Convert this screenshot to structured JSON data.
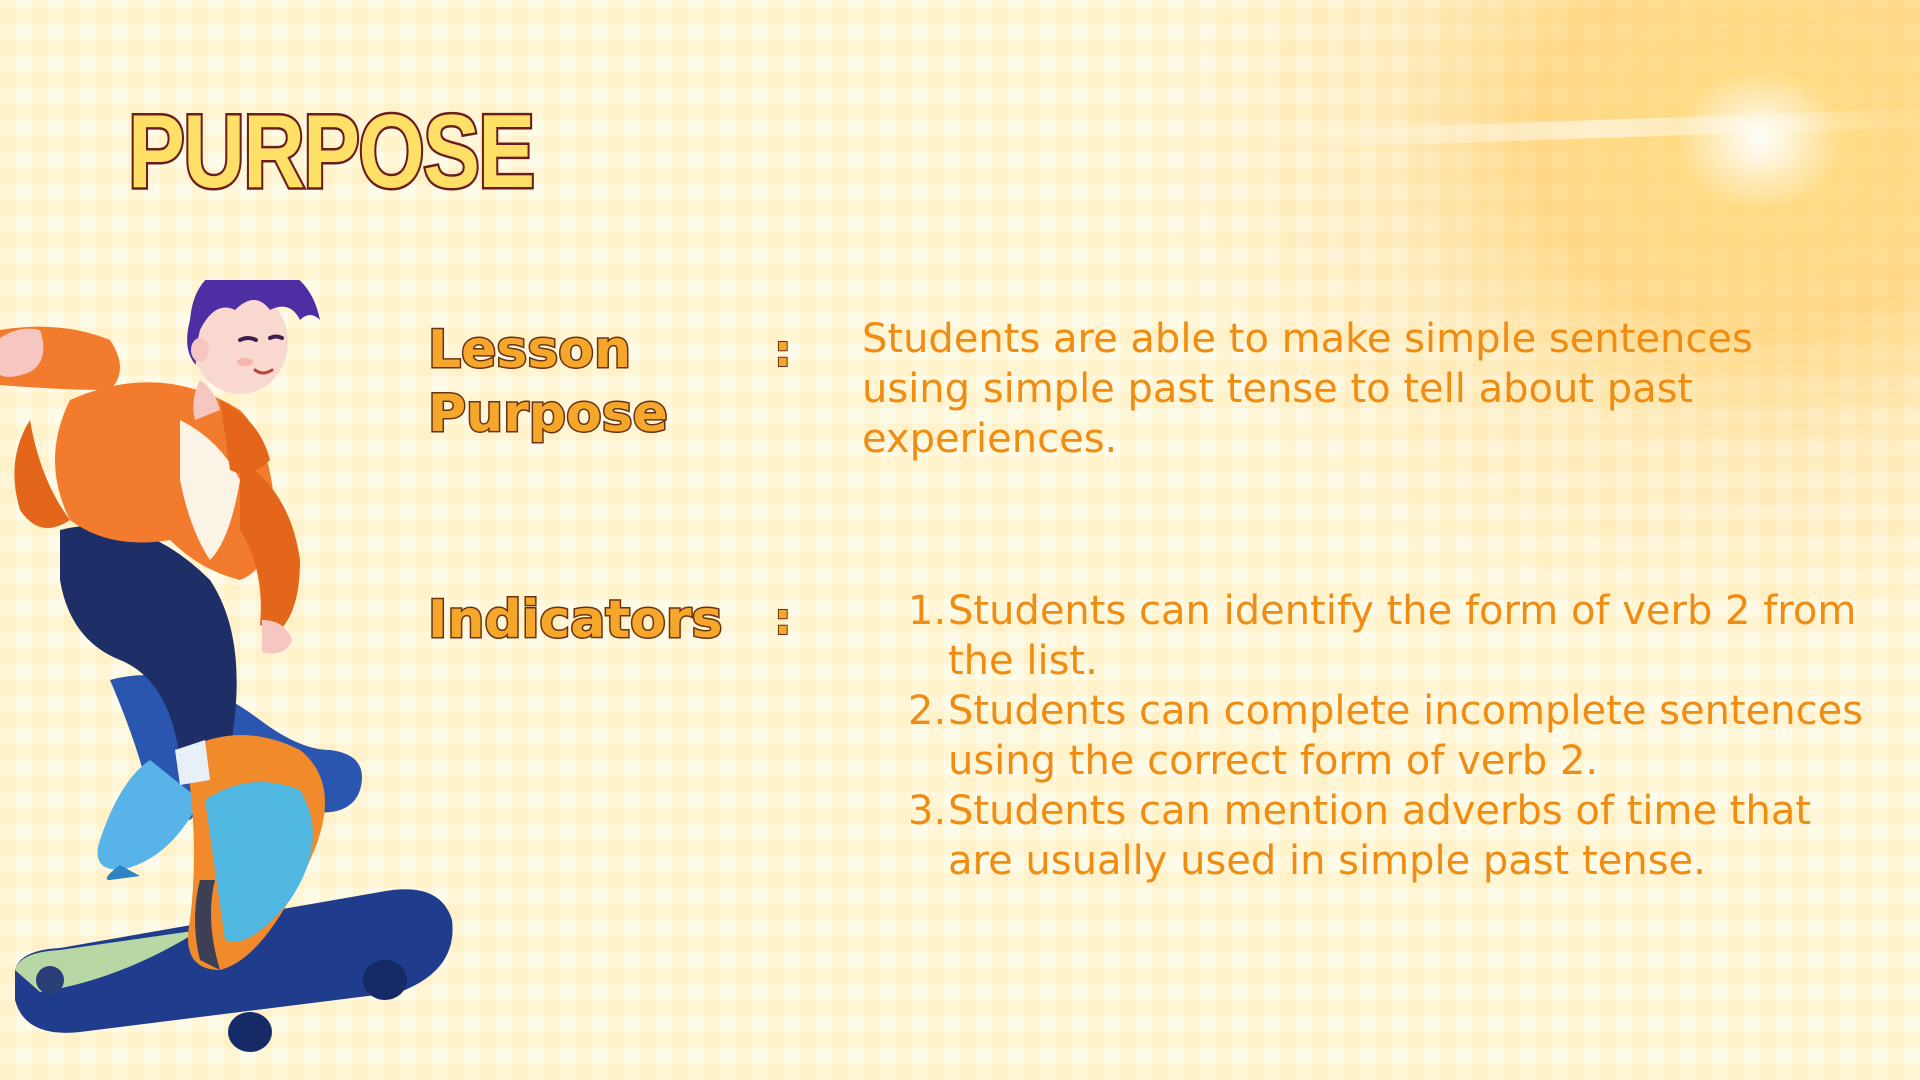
{
  "slide": {
    "title": "PURPOSE"
  },
  "lesson_purpose": {
    "label": "Lesson Purpose",
    "separator": ":",
    "text": "Students are able to make simple sentences using simple past tense to tell about past experiences."
  },
  "indicators": {
    "label": "Indicators",
    "separator": ":",
    "items": [
      {
        "number": "1.",
        "text": "Students can identify the form of verb 2 from the list."
      },
      {
        "number": "2.",
        "text": "Students can complete incomplete sentences using the correct form of verb 2."
      },
      {
        "number": "3.",
        "text": "Students can mention adverbs of time that are usually used in simple past tense."
      }
    ]
  },
  "colors": {
    "title_fill": "#ffe066",
    "title_outline": "#6b1d1d",
    "label_fill": "#f5a72c",
    "body_text": "#f08c12",
    "background": "#fffbe9"
  },
  "illustration": {
    "name": "skateboarder-illustration"
  }
}
